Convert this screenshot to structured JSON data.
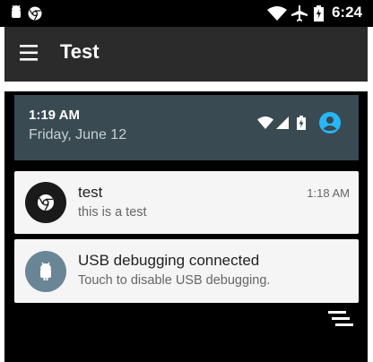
{
  "status_bar": {
    "time": "6:24",
    "left_icons": [
      "android-icon",
      "chrome-icon"
    ],
    "right_icons": [
      "wifi-icon",
      "airplane-mode-icon",
      "battery-charging-icon"
    ]
  },
  "app_bar": {
    "menu_icon": "hamburger-menu-icon",
    "title": "Test"
  },
  "quick_settings": {
    "time": "1:19 AM",
    "date": "Friday, June 12",
    "icons": [
      "wifi-icon",
      "cell-signal-icon",
      "battery-charging-icon",
      "user-account-icon"
    ],
    "accent": "#29b6f6"
  },
  "notifications": [
    {
      "icon": "chrome-icon",
      "title": "test",
      "text": "this is a test",
      "time": "1:18 AM"
    },
    {
      "icon": "android-icon",
      "title": "USB debugging connected",
      "text": "Touch to disable USB debugging."
    }
  ],
  "shade_actions": {
    "clear_all_icon": "clear-all-icon"
  }
}
